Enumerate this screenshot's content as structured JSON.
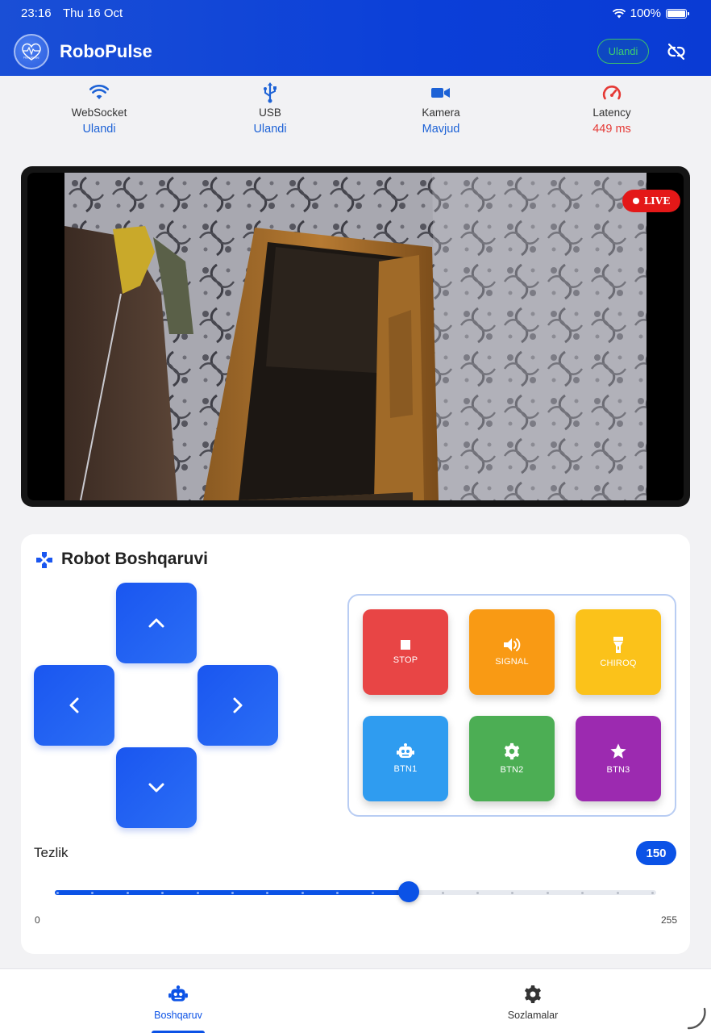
{
  "status_bar": {
    "time": "23:16",
    "date": "Thu 16 Oct",
    "battery": "100%"
  },
  "header": {
    "app_title": "RoboPulse",
    "logo_text": "RoboPulse",
    "connection_badge": "Ulandi"
  },
  "status_strip": [
    {
      "label": "WebSocket",
      "value": "Ulandi",
      "icon": "wifi-icon"
    },
    {
      "label": "USB",
      "value": "Ulandi",
      "icon": "usb-icon"
    },
    {
      "label": "Kamera",
      "value": "Mavjud",
      "icon": "video-camera-icon"
    },
    {
      "label": "Latency",
      "value": "449 ms",
      "icon": "speedometer-icon"
    }
  ],
  "camera": {
    "live_label": "LIVE"
  },
  "control": {
    "title": "Robot Boshqaruvi",
    "actions": [
      {
        "label": "STOP",
        "icon": "stop-icon",
        "color": "#e84545"
      },
      {
        "label": "SIGNAL",
        "icon": "speaker-icon",
        "color": "#f99a14"
      },
      {
        "label": "CHIROQ",
        "icon": "flashlight-icon",
        "color": "#fbc21a"
      },
      {
        "label": "BTN1",
        "icon": "robot-icon",
        "color": "#2f9cf0"
      },
      {
        "label": "BTN2",
        "icon": "gear-icon",
        "color": "#4cae54"
      },
      {
        "label": "BTN3",
        "icon": "star-icon",
        "color": "#9c2ab0"
      }
    ],
    "speed": {
      "label": "Tezlik",
      "value": "150",
      "min": "0",
      "max": "255",
      "value_num": 150,
      "max_num": 255
    }
  },
  "bottom_nav": [
    {
      "label": "Boshqaruv",
      "icon": "robot-icon",
      "active": true
    },
    {
      "label": "Sozlamalar",
      "icon": "gear-icon",
      "active": false
    }
  ],
  "colors": {
    "primary": "#0b52e6",
    "header": "#0b3fd8",
    "success": "#3cc06a",
    "danger": "#e53935"
  }
}
